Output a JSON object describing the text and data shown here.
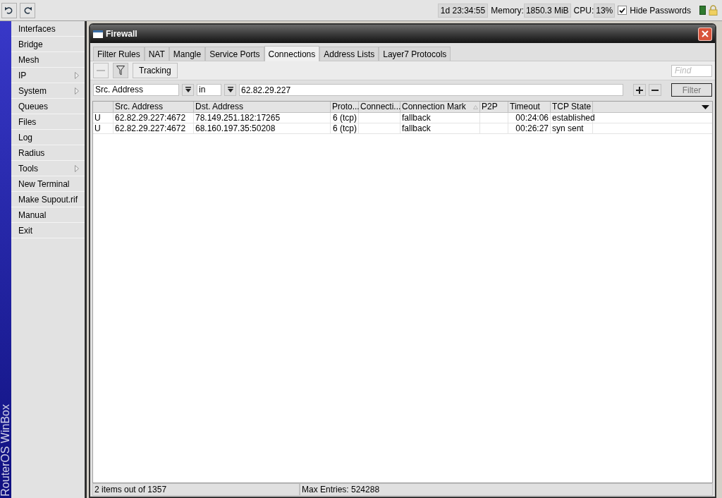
{
  "status": {
    "uptime": "1d 23:34:55",
    "memory_label": "Memory:",
    "memory": "1850.3 MiB",
    "cpu_label": "CPU:",
    "cpu": "13%",
    "hide_passwords": {
      "label": "Hide Passwords",
      "checked": true
    }
  },
  "sidebar": {
    "vertical_title": "RouterOS WinBox",
    "items": [
      {
        "label": "Interfaces",
        "submenu": false
      },
      {
        "label": "Bridge",
        "submenu": false
      },
      {
        "label": "Mesh",
        "submenu": false
      },
      {
        "label": "IP",
        "submenu": true
      },
      {
        "label": "System",
        "submenu": true
      },
      {
        "label": "Queues",
        "submenu": false
      },
      {
        "label": "Files",
        "submenu": false
      },
      {
        "label": "Log",
        "submenu": false
      },
      {
        "label": "Radius",
        "submenu": false
      },
      {
        "label": "Tools",
        "submenu": true
      },
      {
        "label": "New Terminal",
        "submenu": false
      },
      {
        "label": "Make Supout.rif",
        "submenu": false
      },
      {
        "label": "Manual",
        "submenu": false
      },
      {
        "label": "Exit",
        "submenu": false
      }
    ]
  },
  "window": {
    "title": "Firewall",
    "tabs": [
      {
        "label": "Filter Rules",
        "selected": false
      },
      {
        "label": "NAT",
        "selected": false
      },
      {
        "label": "Mangle",
        "selected": false
      },
      {
        "label": "Service Ports",
        "selected": false
      },
      {
        "label": "Connections",
        "selected": true
      },
      {
        "label": "Address Lists",
        "selected": false
      },
      {
        "label": "Layer7 Protocols",
        "selected": false
      }
    ],
    "toolbar": {
      "tracking": "Tracking",
      "find_placeholder": "Find"
    },
    "filter": {
      "field": "Src. Address",
      "operator": "in",
      "value": "62.82.29.227",
      "button": "Filter"
    },
    "table": {
      "columns": [
        "",
        "Src. Address",
        "Dst. Address",
        "Proto...",
        "Connecti...",
        "Connection Mark",
        "P2P",
        "Timeout",
        "TCP State"
      ],
      "rows": [
        [
          "U",
          "62.82.29.227:4672",
          "78.149.251.182:17265",
          "6 (tcp)",
          "",
          "fallback",
          "",
          "00:24:06",
          "established"
        ],
        [
          "U",
          "62.82.29.227:4672",
          "68.160.197.35:50208",
          "6 (tcp)",
          "",
          "fallback",
          "",
          "00:26:27",
          "syn sent"
        ]
      ]
    },
    "status_bar": [
      "2 items out of 1357",
      "Max Entries: 524288"
    ]
  }
}
